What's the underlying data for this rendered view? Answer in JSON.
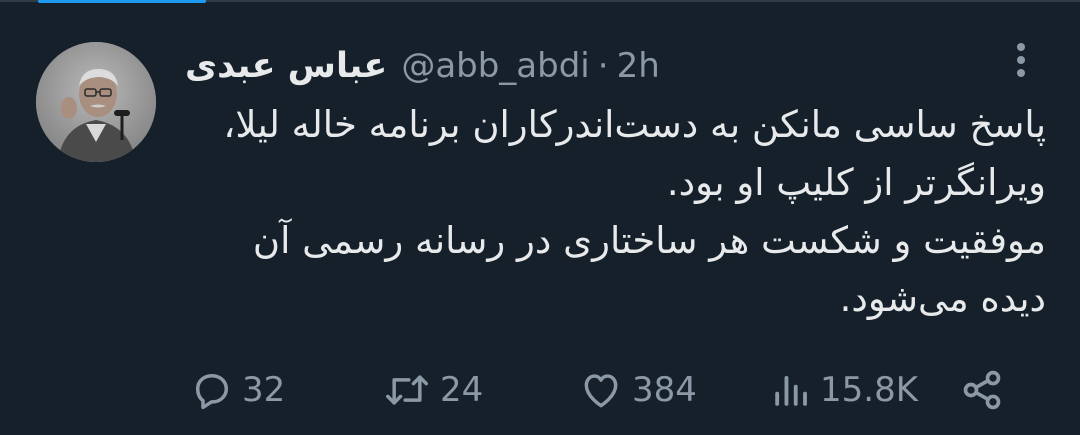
{
  "tweet": {
    "display_name": "عباس عبدی",
    "handle": "@abb_abdi",
    "separator": "·",
    "time": "2h",
    "text": "پاسخ ساسی مانکن به دست‌اندرکاران برنامه خاله لیلا، ویرانگرتر از کلیپ او بود.\nموفقیت و شکست هر ساختاری در رسانه رسمی آن دیده می‌شود."
  },
  "actions": {
    "replies": "32",
    "retweets": "24",
    "likes": "384",
    "views": "15.8K"
  },
  "icons": {
    "more": "more-vertical-icon",
    "reply": "reply-icon",
    "retweet": "retweet-icon",
    "like": "heart-icon",
    "views": "views-icon",
    "share": "share-icon"
  },
  "colors": {
    "background": "#15202b",
    "text": "#e7e9ea",
    "secondary": "#8b98a5",
    "accent": "#1d9bf0"
  }
}
